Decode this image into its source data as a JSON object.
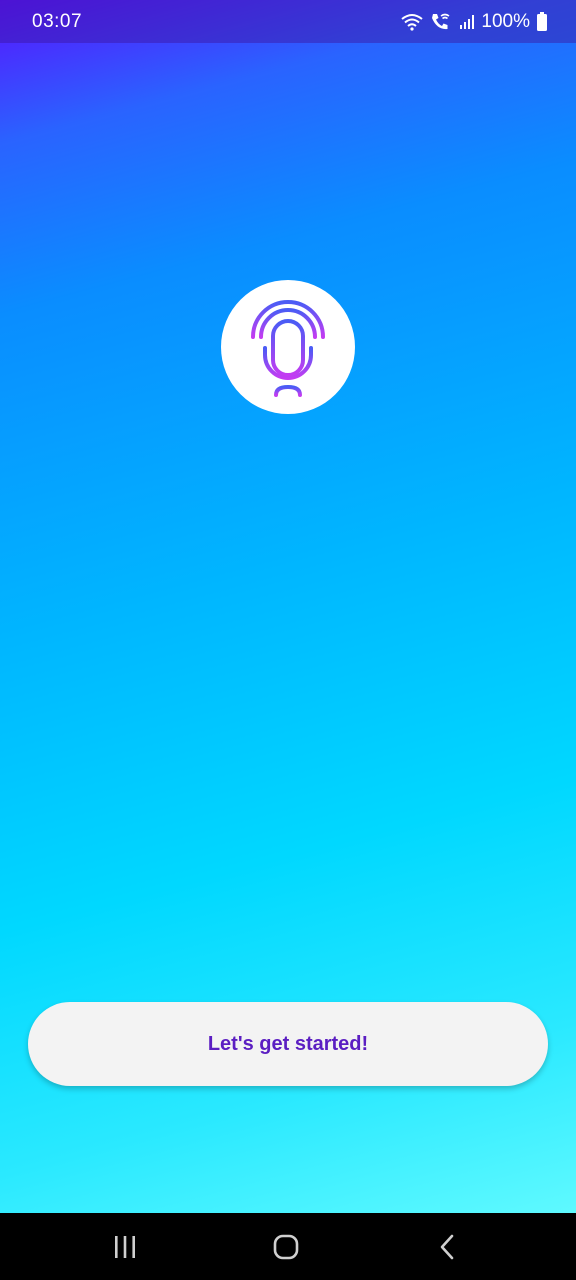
{
  "status_bar": {
    "time": "03:07",
    "battery": "100%",
    "icons": [
      "wifi-icon",
      "wifi-call-icon",
      "signal-icon",
      "battery-icon"
    ]
  },
  "logo": {
    "icon": "microphone-icon"
  },
  "start_button": {
    "label": "Let's get started!"
  },
  "nav_bar": {
    "buttons": [
      "recent-apps-icon",
      "home-icon",
      "back-icon"
    ]
  },
  "colors": {
    "gradient_top": "#5a12ff",
    "gradient_bottom": "#71ffff",
    "button_text": "#5b1ec2",
    "logo_gradient_start": "#4a5cf5",
    "logo_gradient_end": "#c43cf2"
  }
}
